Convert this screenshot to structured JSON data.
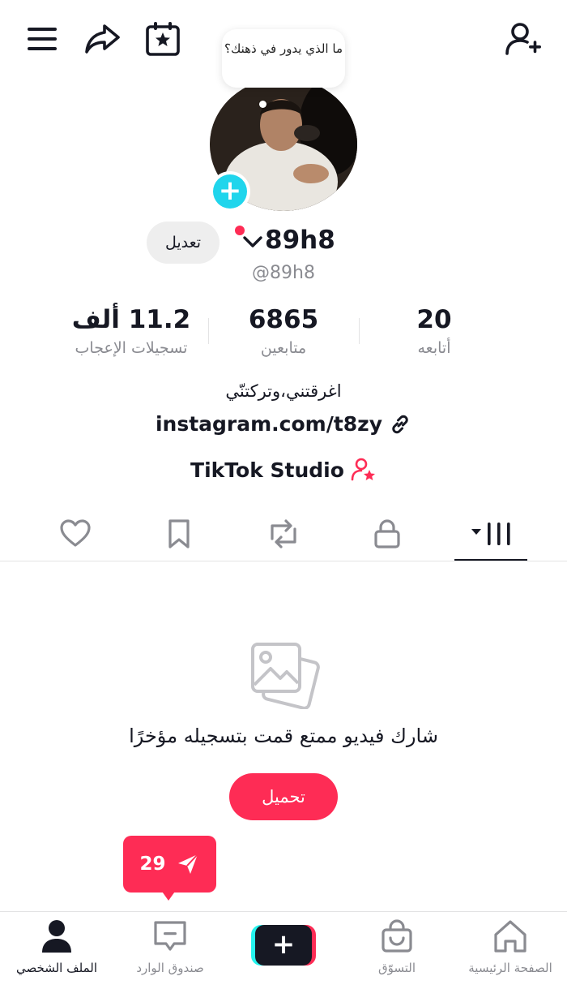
{
  "header": {
    "menu_icon": "hamburger-icon",
    "share_icon": "share-arrow-icon",
    "calendar_icon": "calendar-star-icon",
    "add_friend_icon": "add-user-icon"
  },
  "profile": {
    "note_bubble": "ما الذي يدور في ذهنك؟",
    "edit_label": "تعديل",
    "username": "89h8",
    "handle": "@89h8"
  },
  "stats": [
    {
      "value": "20",
      "label": "أتابعه"
    },
    {
      "value": "6865",
      "label": "متابعين"
    },
    {
      "value": "11.2 ألف",
      "label": "تسجيلات الإعجاب"
    }
  ],
  "bio": {
    "text": "اغرقتني،وتركتنّي",
    "link": "instagram.com/t8zy",
    "studio": "TikTok Studio"
  },
  "tabs": [
    "videos-grid",
    "private",
    "reposts",
    "favorites",
    "liked"
  ],
  "empty_state": {
    "title": "شارك فيديو ممتع قمت بتسجيله مؤخرًا",
    "upload_label": "تحميل"
  },
  "dm_badge": {
    "count": "29"
  },
  "bottom_nav": {
    "home": "الصفحة الرئيسية",
    "shop": "التسوّق",
    "inbox": "صندوق الوارد",
    "profile": "الملف الشخصي"
  },
  "colors": {
    "accent": "#fe2c55",
    "cyan": "#25f4ee",
    "text": "#161823",
    "muted": "#8a8b91"
  }
}
